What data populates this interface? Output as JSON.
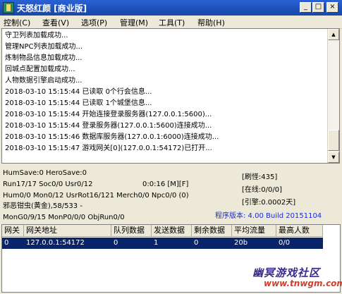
{
  "window": {
    "title": "天怒红颜 [商业版]"
  },
  "menu": {
    "items": [
      "控制(C)",
      "查看(V)",
      "选项(P)",
      "管理(M)",
      "工具(T)",
      "帮助(H)"
    ]
  },
  "log": {
    "lines": [
      "守卫列表加载成功...",
      "管理NPC列表加载成功...",
      "炼制物品信息加载成功...",
      "回城点配置加载成功...",
      "人物数据引擎启动成功...",
      "2018-03-10 15:15:44 已读取 0个行会信息...",
      "2018-03-10 15:15:44 已读取 1个城堡信息...",
      "2018-03-10 15:15:44 开始连接登录服务器(127.0.0.1:5600)...",
      "2018-03-10 15:15:44 登录服务器(127.0.0.1:5600)连接成功...",
      "2018-03-10 15:15:46 数据库服务器(127.0.0.1:6000)连接成功...",
      "2018-03-10 15:15:47 游戏网关[0](127.0.0.1:54172)已打开..."
    ]
  },
  "status": {
    "hum_save": "HumSave:0 HeroSave:0",
    "run": "Run17/17 Soc0/0 Usr0/12",
    "time": "0:0:16 [M][F]",
    "hum": "Hum0/0 Mon0/12 UsrRot16/121 Merch0/0 Npc0/0 (0)",
    "monster": "邪恶钳虫(黄金),58/533 -",
    "mon_gen": "MonG0/9/15 MonP0/0/0 ObjRun0/0",
    "refresh": "[刷怪:435]",
    "online": "[在线:0/0/0]",
    "engine": "[引擎:0.0002天]",
    "version": "程序版本: 4.00 Build 20151104"
  },
  "grid": {
    "headers": [
      "网关",
      "网关地址",
      "队列数据",
      "发送数据",
      "剩余数据",
      "平均流量",
      "最高人数"
    ],
    "row": [
      "0",
      "127.0.0.1:54172",
      "0",
      "1",
      "0",
      "20b",
      "0/0"
    ]
  },
  "watermark": {
    "text": "幽冥游戏社区",
    "url": "www.tnwgm.com"
  }
}
